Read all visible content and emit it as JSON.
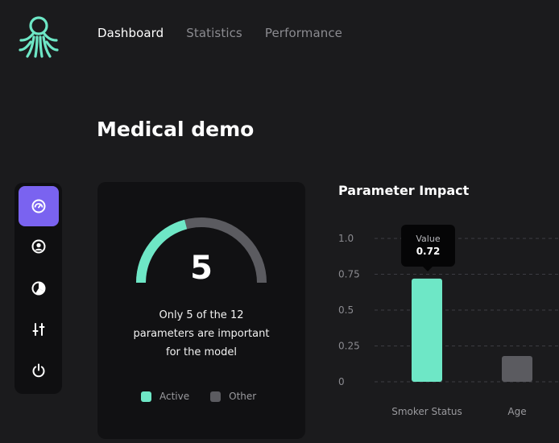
{
  "nav": {
    "items": [
      {
        "label": "Dashboard",
        "active": true
      },
      {
        "label": "Statistics",
        "active": false
      },
      {
        "label": "Performance",
        "active": false
      }
    ]
  },
  "page": {
    "title": "Medical demo"
  },
  "sidebar": {
    "items": [
      {
        "icon": "gauge-icon",
        "active": true
      },
      {
        "icon": "user-icon",
        "active": false
      },
      {
        "icon": "pie-chart-icon",
        "active": false
      },
      {
        "icon": "sliders-icon",
        "active": false
      },
      {
        "icon": "power-icon",
        "active": false
      }
    ]
  },
  "summary_card": {
    "value": "5",
    "description_lines": [
      "Only 5 of the 12",
      "parameters are important",
      "for the model"
    ],
    "gauge": {
      "active": 5,
      "total": 12
    },
    "legend": [
      {
        "label": "Active",
        "color": "#6ee7c6"
      },
      {
        "label": "Other",
        "color": "#5b5b60"
      }
    ]
  },
  "impact_chart": {
    "title": "Parameter Impact",
    "tooltip": {
      "label": "Value",
      "value": "0.72"
    }
  },
  "chart_data": {
    "type": "bar",
    "title": "Parameter Impact",
    "categories": [
      "Smoker Status",
      "Age"
    ],
    "values": [
      0.72,
      0.18
    ],
    "colors": [
      "#6ee7c6",
      "#5b5b60"
    ],
    "yticks": [
      "0",
      "0.25",
      "0.5",
      "0.75",
      "1.0"
    ],
    "ylim": [
      0,
      1.0
    ],
    "grid": true,
    "grid_style": "dashed"
  },
  "colors": {
    "background": "#1b1b1d",
    "card": "#111113",
    "accent": "#6ee7c6",
    "primary": "#7a63f0",
    "muted": "#5b5b60"
  }
}
